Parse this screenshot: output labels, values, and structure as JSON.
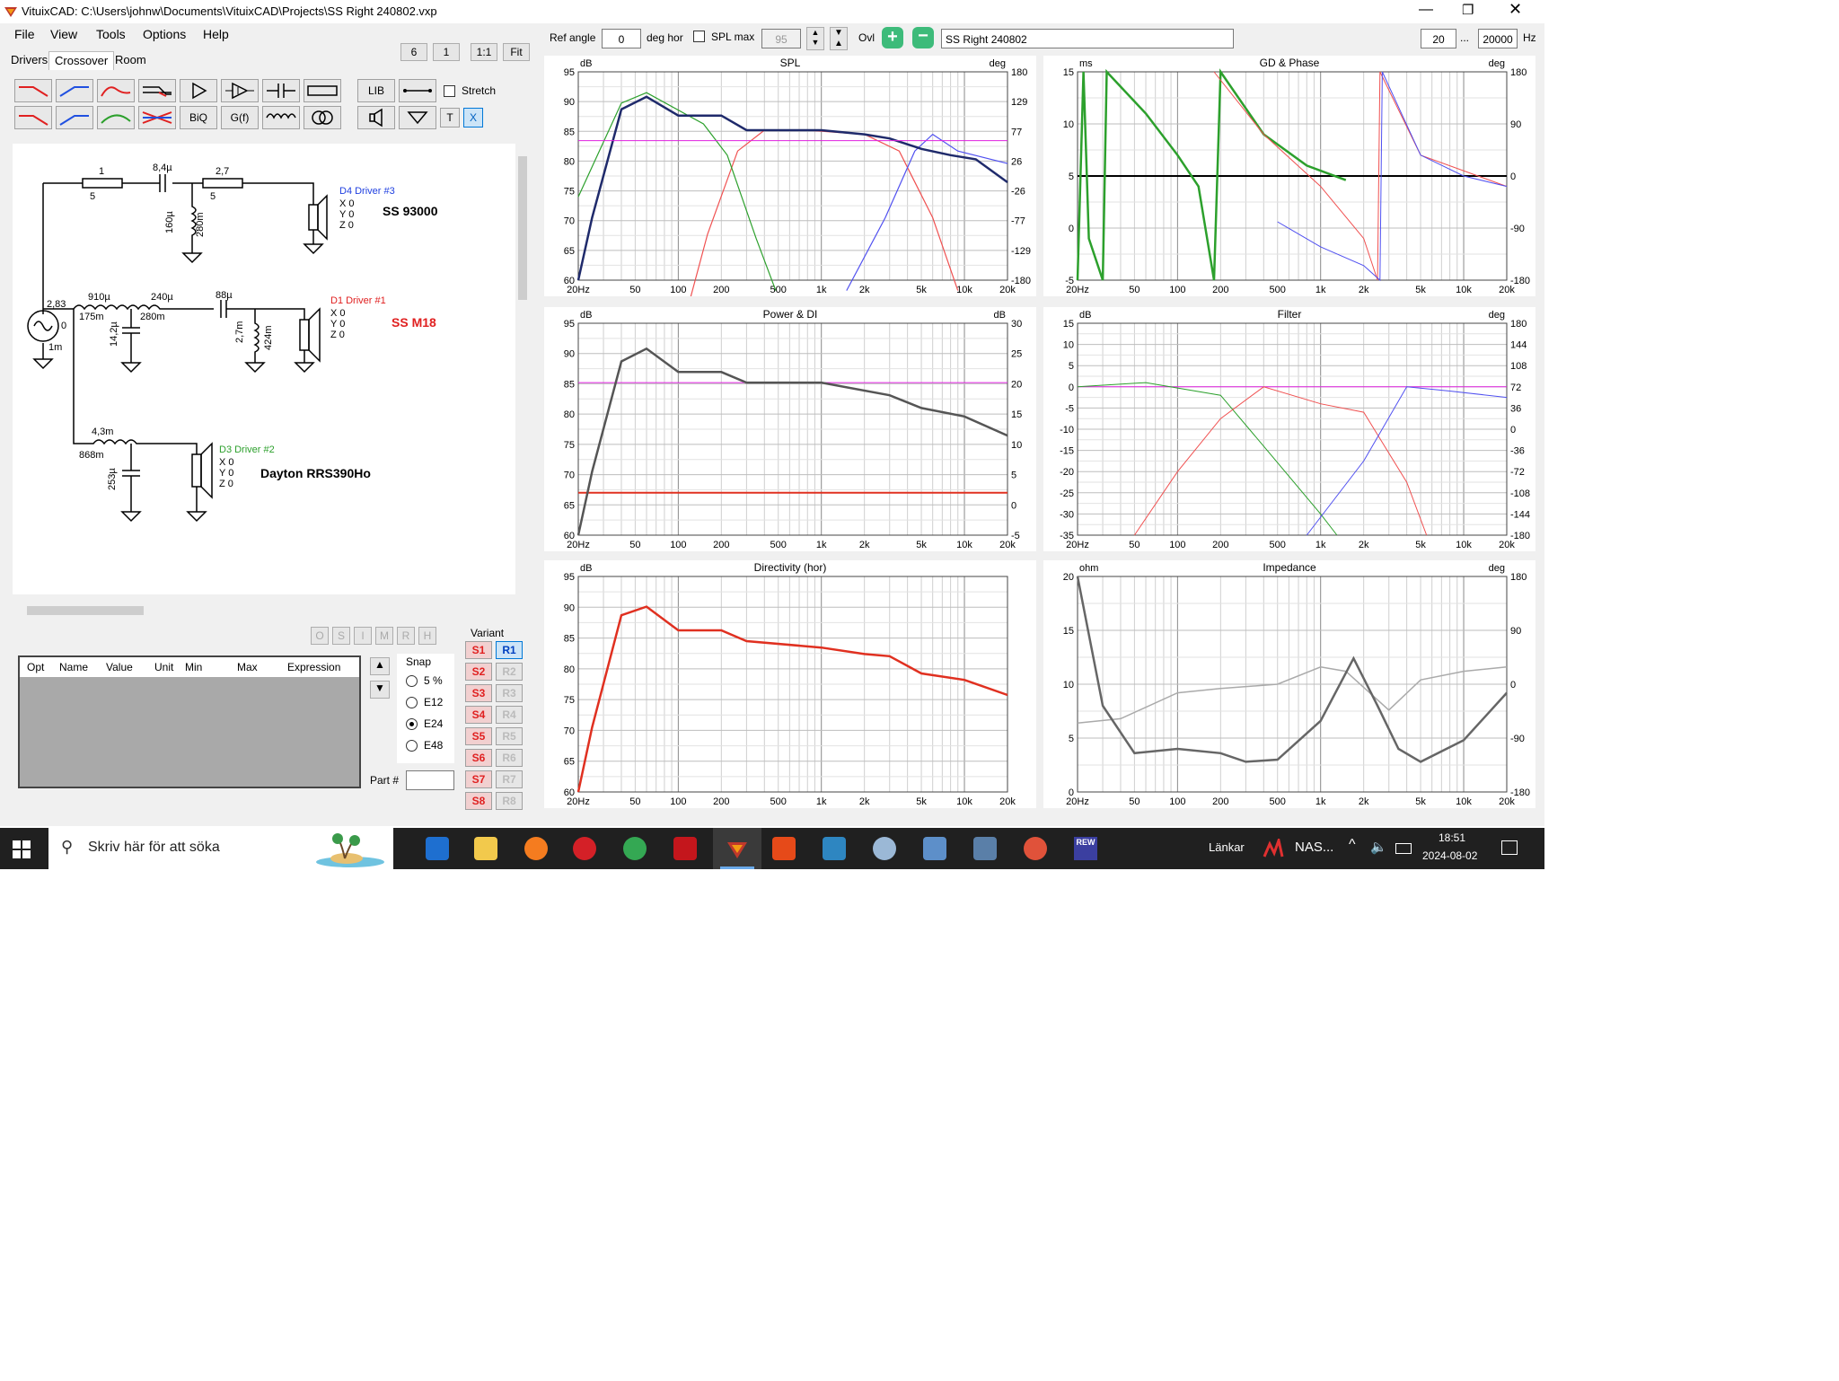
{
  "window": {
    "title": "VituixCAD: C:\\Users\\johnw\\Documents\\VituixCAD\\Projects\\SS Right 240802.vxp"
  },
  "menu": [
    "File",
    "View",
    "Tools",
    "Options",
    "Help"
  ],
  "tabs": [
    "Drivers",
    "Crossover",
    "Room"
  ],
  "zoom_buttons": [
    "6",
    "1",
    "1:1",
    "Fit"
  ],
  "toolbar": {
    "lib": "LIB",
    "biq": "BiQ",
    "gf": "G(f)",
    "t": "T",
    "x": "X",
    "stretch_label": "Stretch"
  },
  "top_controls": {
    "ref_angle_label": "Ref angle",
    "ref_angle_value": "0",
    "deg_hor": "deg hor",
    "spl_max_label": "SPL max",
    "spl_max_value": "95",
    "ovl_label": "Ovl",
    "project_name": "SS Right 240802",
    "freq_min": "20",
    "freq_sep": "...",
    "freq_max": "20000",
    "hz": "Hz"
  },
  "schematic": {
    "labels": {
      "r1": "1",
      "r1b": "5",
      "c1": "8,4µ",
      "r2": "2,7",
      "r2b": "5",
      "l_shunt": "160µ",
      "l_shunt_r": "280m",
      "d4": "D4 Driver #3",
      "d4_name": "SS 93000",
      "l1": "910µ",
      "l1r": "175m",
      "l2": "240µ",
      "l2r": "280m",
      "c2": "88µ",
      "c_shunt": "14,2µ",
      "l3": "2,7m",
      "l3r": "424m",
      "d1": "D1 Driver #1",
      "d1_name": "SS M18",
      "src_v": "2,83",
      "src_z": "0",
      "src_r": "1m",
      "l4": "4,3m",
      "l4r": "868m",
      "c3": "253µ",
      "d3": "D3 Driver #2",
      "d3_name": "Dayton RRS390Ho",
      "x0": "X 0",
      "y0": "Y 0",
      "z0": "Z 0"
    }
  },
  "opt_buttons": [
    "O",
    "S",
    "I",
    "M",
    "R",
    "H"
  ],
  "opt_table": {
    "columns": [
      "Opt",
      "Name",
      "Value",
      "Unit",
      "Min",
      "Max",
      "Expression"
    ]
  },
  "snap": {
    "label": "Snap",
    "options": [
      "5 %",
      "E12",
      "E24",
      "E48"
    ],
    "selected": "E24",
    "part_label": "Part #"
  },
  "variant": {
    "label": "Variant",
    "s": [
      "S1",
      "S2",
      "S3",
      "S4",
      "S5",
      "S6",
      "S7",
      "S8"
    ],
    "r": [
      "R1",
      "R2",
      "R3",
      "R4",
      "R5",
      "R6",
      "R7",
      "R8"
    ],
    "selected_r": "R1"
  },
  "colors": {
    "woofer": "#2ca02c",
    "mid": "#f05050",
    "tweeter": "#5050f0",
    "total": "#1f2a6b",
    "ref": "#e020e0",
    "power": "#555555",
    "di": "#e03020"
  },
  "charts": [
    {
      "title": "SPL",
      "yunit_left": "dB",
      "yunit_right": "deg",
      "yticks_left": [
        "95",
        "90",
        "85",
        "80",
        "75",
        "70",
        "65",
        "60"
      ],
      "yticks_right": [
        "180",
        "129",
        "77",
        "26",
        "-26",
        "-77",
        "-129",
        "-180"
      ]
    },
    {
      "title": "GD & Phase",
      "yunit_left": "ms",
      "yunit_right": "deg",
      "yticks_left": [
        "15",
        "10",
        "5",
        "0",
        "-5"
      ],
      "yticks_right": [
        "180",
        "90",
        "0",
        "-90",
        "-180"
      ]
    },
    {
      "title": "Power & DI",
      "yunit_left": "dB",
      "yunit_right": "dB",
      "yticks_left": [
        "95",
        "90",
        "85",
        "80",
        "75",
        "70",
        "65",
        "60"
      ],
      "yticks_right": [
        "30",
        "25",
        "20",
        "15",
        "10",
        "5",
        "0",
        "-5"
      ]
    },
    {
      "title": "Filter",
      "yunit_left": "dB",
      "yunit_right": "deg",
      "yticks_left": [
        "15",
        "10",
        "5",
        "0",
        "-5",
        "-10",
        "-15",
        "-20",
        "-25",
        "-30",
        "-35"
      ],
      "yticks_right": [
        "180",
        "144",
        "108",
        "72",
        "36",
        "0",
        "-36",
        "-72",
        "-108",
        "-144",
        "-180"
      ]
    },
    {
      "title": "Directivity (hor)",
      "yunit_left": "dB",
      "yunit_right": "",
      "yticks_left": [
        "95",
        "90",
        "85",
        "80",
        "75",
        "70",
        "65",
        "60"
      ],
      "yticks_right": []
    },
    {
      "title": "Impedance",
      "yunit_left": "ohm",
      "yunit_right": "deg",
      "yticks_left": [
        "20",
        "15",
        "10",
        "5",
        "0"
      ],
      "yticks_right": [
        "180",
        "90",
        "0",
        "-90",
        "-180"
      ]
    }
  ],
  "xticks": [
    "20Hz",
    "50",
    "100",
    "200",
    "500",
    "1k",
    "2k",
    "5k",
    "10k",
    "20k"
  ],
  "taskbar": {
    "search_placeholder": "Skriv här för att söka",
    "links": "Länkar",
    "nas": "NAS...",
    "time": "18:51",
    "date": "2024-08-02",
    "rew": "REW"
  }
}
